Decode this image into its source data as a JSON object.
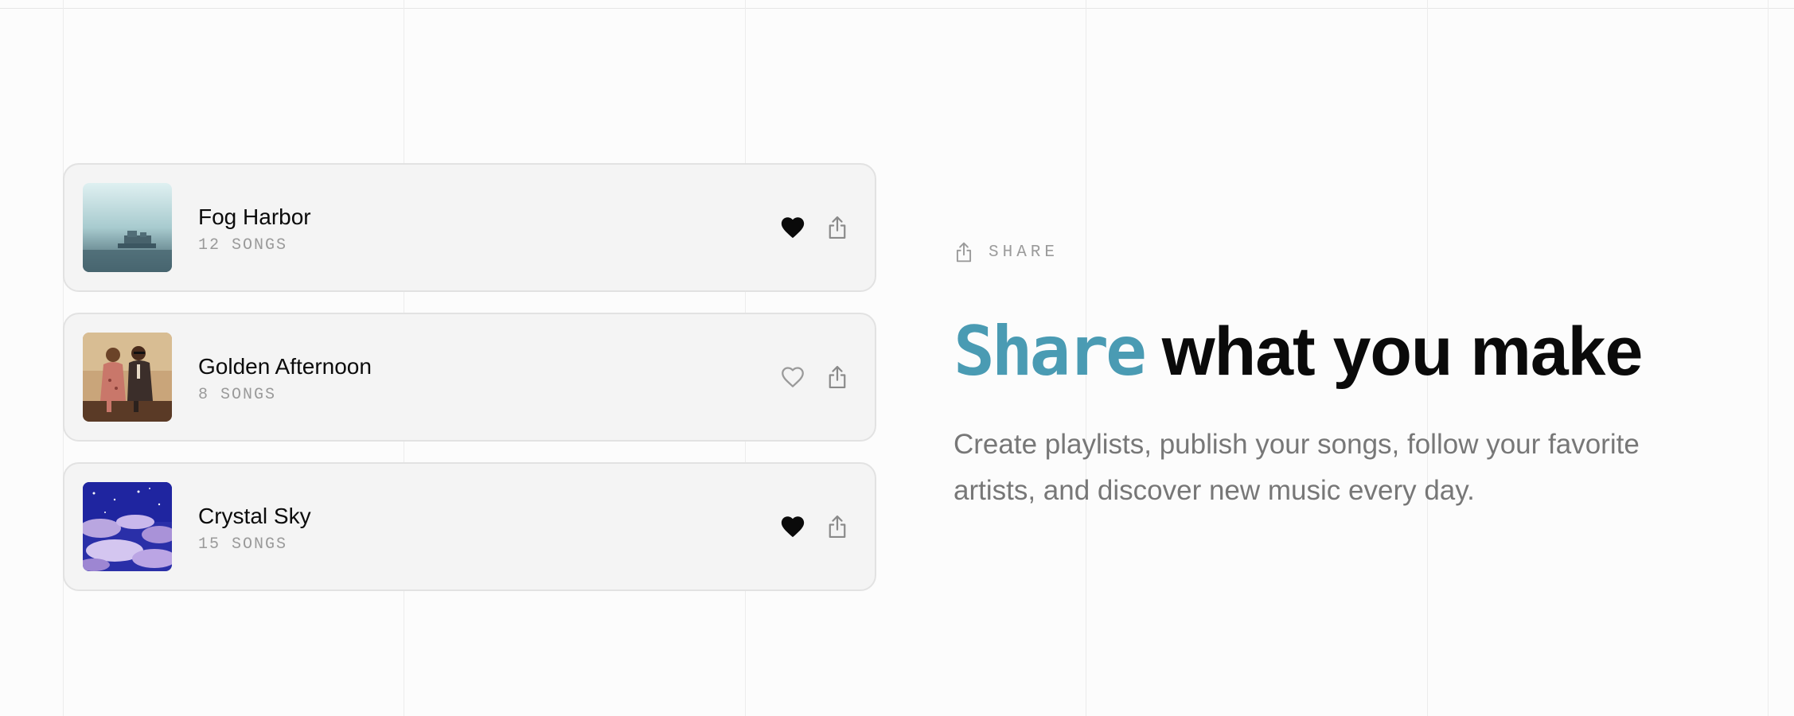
{
  "playlists": [
    {
      "title": "Fog Harbor",
      "subtitle": "12 SONGS",
      "liked": true,
      "artwork": "misty-harbor-photo"
    },
    {
      "title": "Golden Afternoon",
      "subtitle": "8 SONGS",
      "liked": false,
      "artwork": "vintage-couple-painting"
    },
    {
      "title": "Crystal Sky",
      "subtitle": "15 SONGS",
      "liked": true,
      "artwork": "starry-cloud-painting"
    }
  ],
  "hero": {
    "eyebrow": "SHARE",
    "headline_accent": "Share",
    "headline_rest": " what you make",
    "body": "Create playlists, publish your songs, follow your favorite artists, and discover new music every day."
  },
  "icons": {
    "liked": "heart-filled-icon",
    "not_liked": "heart-outline-icon",
    "share": "share-icon"
  },
  "colors": {
    "accent": "#4a9bb3",
    "card_background": "#f4f4f4",
    "card_border": "#e2e2e2",
    "muted_text": "#9a9a9a",
    "body_text": "#777777"
  }
}
